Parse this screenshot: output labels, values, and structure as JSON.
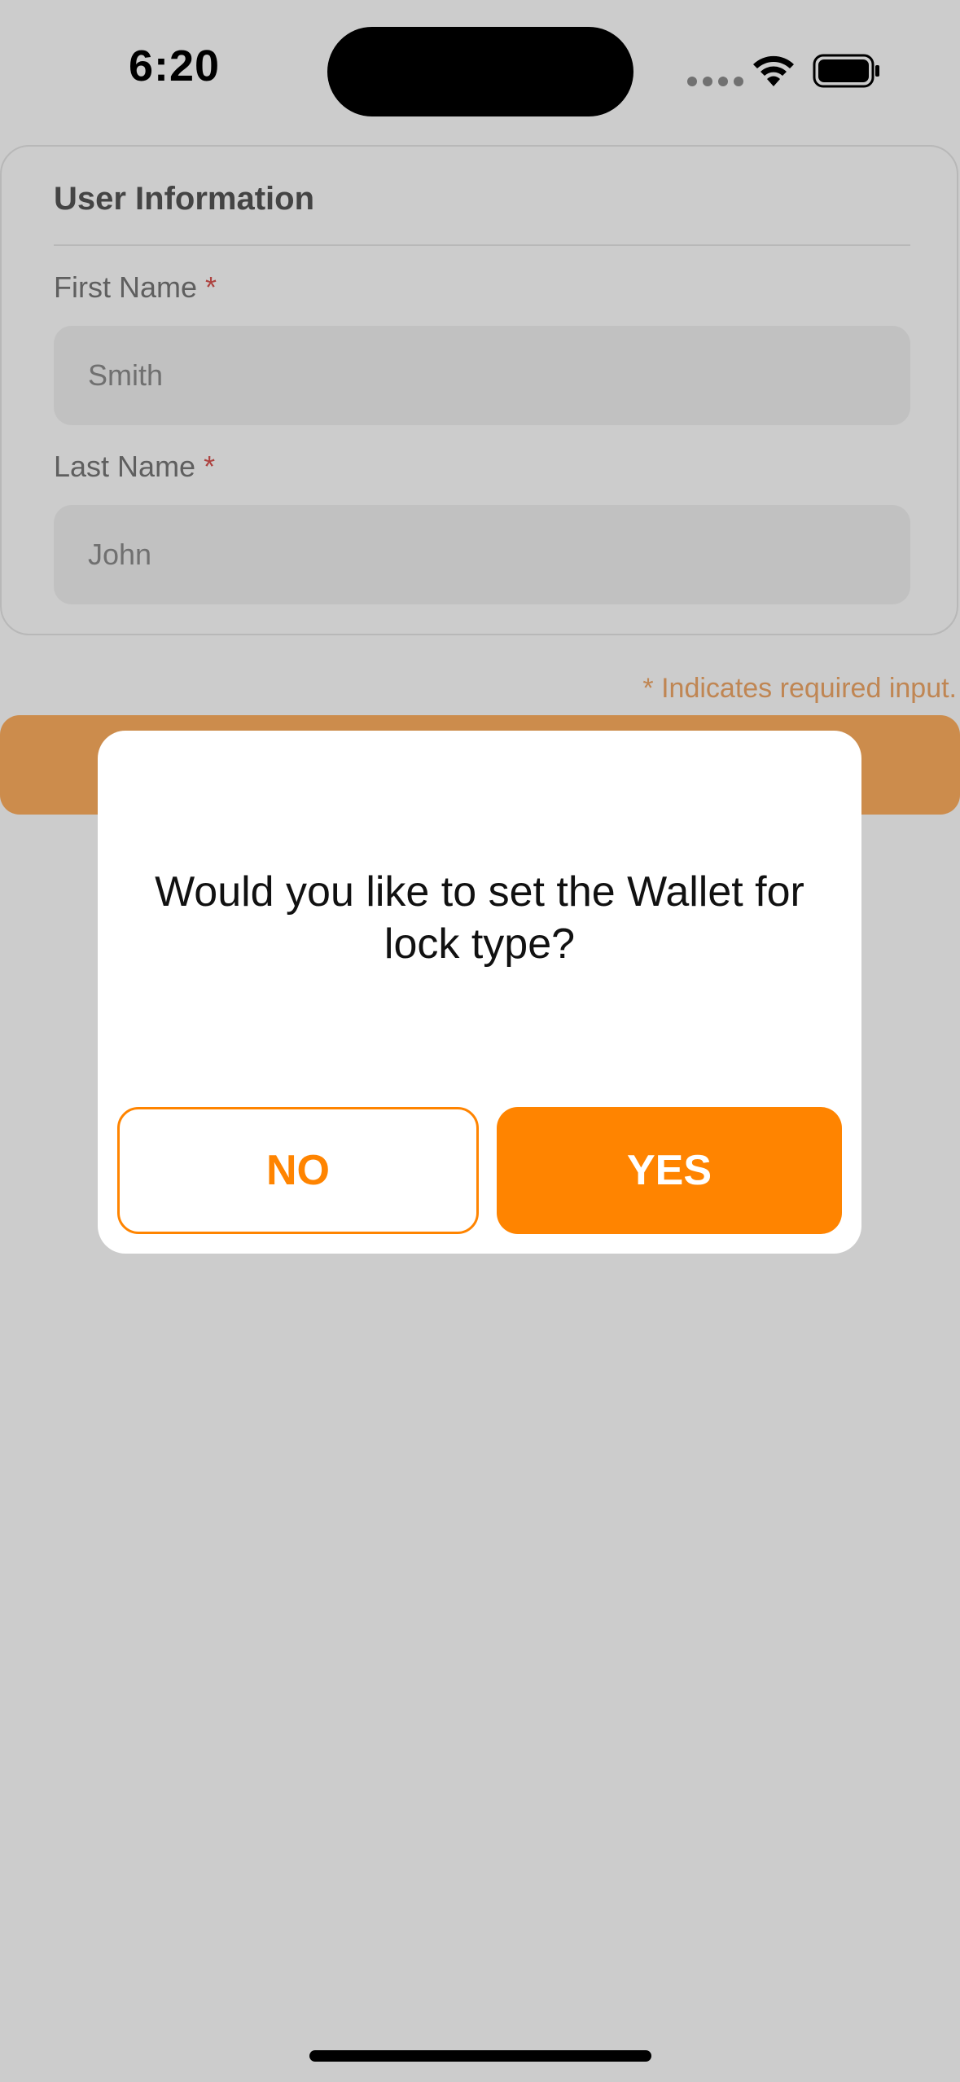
{
  "status_bar": {
    "time": "6:20"
  },
  "form": {
    "title": "User Information",
    "fields": [
      {
        "label": "First Name",
        "required_mark": "*",
        "value": "Smith"
      },
      {
        "label": "Last Name",
        "required_mark": "*",
        "value": "John"
      }
    ],
    "required_note": "* Indicates required input."
  },
  "dialog": {
    "message": "Would you like to set the Wallet for lock type?",
    "no_label": "NO",
    "yes_label": "YES"
  },
  "colors": {
    "accent": "#FF8400",
    "required": "#D9534F"
  }
}
